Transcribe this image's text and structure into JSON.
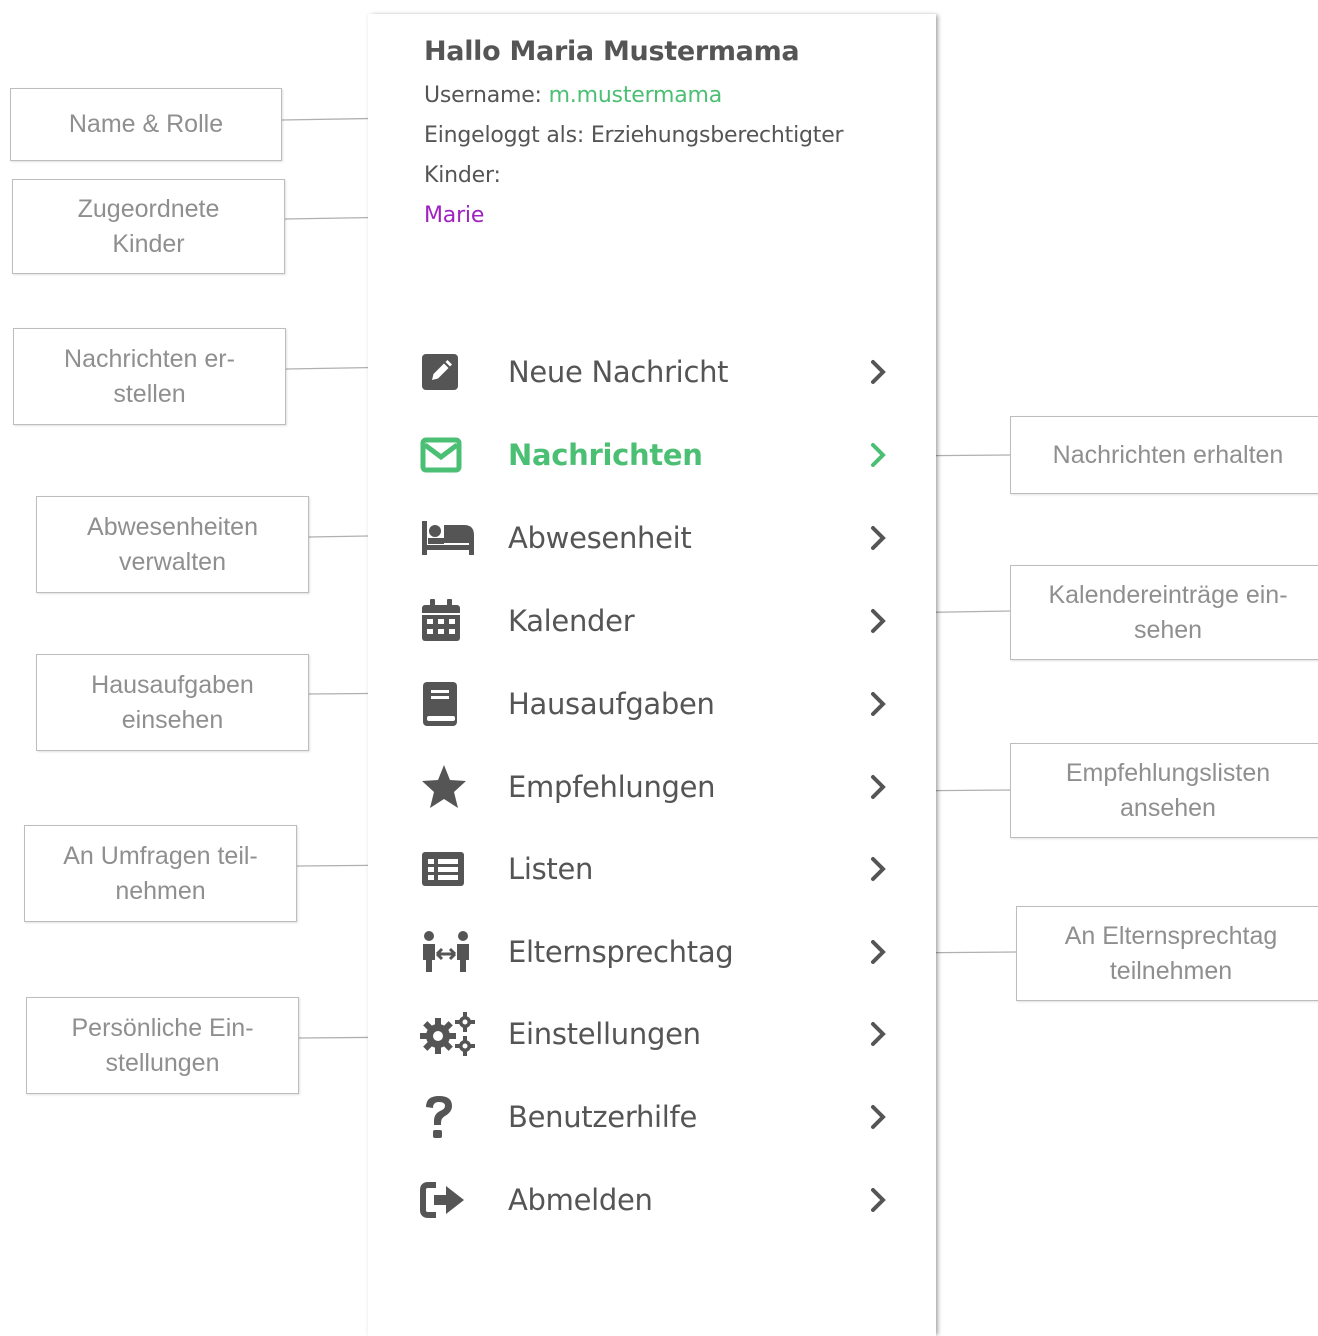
{
  "profile": {
    "greeting": "Hallo Maria Mustermama",
    "username_label": "Username: ",
    "username_value": "m.mustermama",
    "role_line": "Eingeloggt als: Erziehungsberechtigter",
    "children_label": "Kinder:",
    "child_name": "Marie"
  },
  "menu": {
    "items": [
      {
        "label": "Neue Nachricht",
        "icon": "edit-icon"
      },
      {
        "label": "Nachrichten",
        "icon": "envelope-icon",
        "active": true
      },
      {
        "label": "Abwesenheit",
        "icon": "bed-icon"
      },
      {
        "label": "Kalender",
        "icon": "calendar-icon"
      },
      {
        "label": "Hausaufgaben",
        "icon": "book-icon"
      },
      {
        "label": "Empfehlungen",
        "icon": "star-icon"
      },
      {
        "label": "Listen",
        "icon": "list-icon"
      },
      {
        "label": "Elternsprechtag",
        "icon": "people-arrows-icon"
      },
      {
        "label": "Einstellungen",
        "icon": "cogs-icon"
      },
      {
        "label": "Benutzerhilfe",
        "icon": "question-icon"
      },
      {
        "label": "Abmelden",
        "icon": "sign-out-icon"
      }
    ]
  },
  "callouts": {
    "name_rolle": "Name & Rolle",
    "kinder": "Zugeordnete\nKinder",
    "nachrichten_erstellen": "Nachrichten er-\nstellen",
    "abwesenheiten": "Abwesenheiten\nverwalten",
    "hausaufgaben": "Hausaufgaben\neinsehen",
    "umfragen": "An Umfragen teil-\nnehmen",
    "einstellungen": "Persönliche Ein-\nstellungen",
    "nachrichten_erhalten": "Nachrichten erhalten",
    "kalender": "Kalendereinträge ein-\nsehen",
    "empfehlungen": "Empfehlungslisten\nansehen",
    "elternsprechtag": "An Elternsprechtag\nteilnehmen"
  },
  "colors": {
    "accent_green": "#4bbf73",
    "child_link": "#a020c0",
    "text_gray": "#555555",
    "callout_text": "#8f8f8f"
  }
}
